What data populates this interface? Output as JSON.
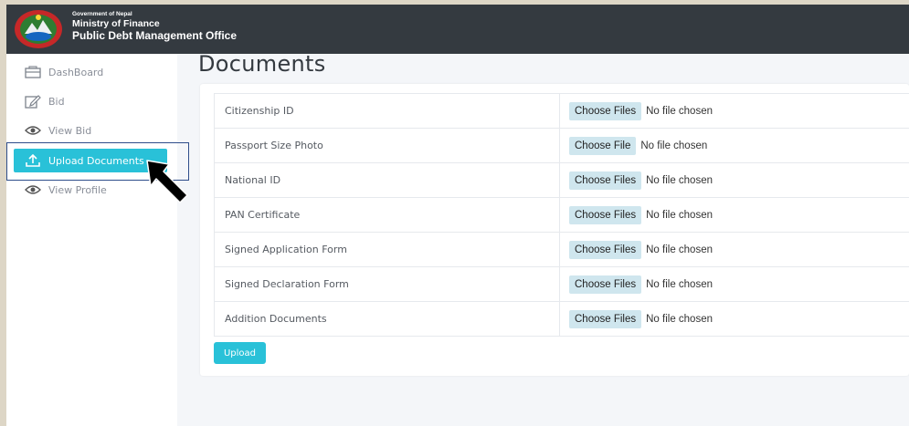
{
  "header": {
    "gov_line": "Government of Nepal",
    "ministry": "Ministry of Finance",
    "office": "Public Debt Management Office"
  },
  "sidebar": {
    "items": [
      {
        "label": "DashBoard",
        "icon": "dashboard-icon"
      },
      {
        "label": "Bid",
        "icon": "edit-icon"
      },
      {
        "label": "View Bid",
        "icon": "eye-icon"
      },
      {
        "label": "Upload Documents",
        "icon": "upload-icon",
        "active": true
      },
      {
        "label": "View Profile",
        "icon": "eye-icon"
      }
    ]
  },
  "main": {
    "title": "Documents",
    "documents": [
      {
        "label": "Citizenship ID",
        "button": "Choose Files",
        "status": "No file chosen"
      },
      {
        "label": "Passport Size Photo",
        "button": "Choose File",
        "status": "No file chosen"
      },
      {
        "label": "National ID",
        "button": "Choose Files",
        "status": "No file chosen"
      },
      {
        "label": "PAN Certificate",
        "button": "Choose Files",
        "status": "No file chosen"
      },
      {
        "label": "Signed Application Form",
        "button": "Choose Files",
        "status": "No file chosen"
      },
      {
        "label": "Signed Declaration Form",
        "button": "Choose Files",
        "status": "No file chosen"
      },
      {
        "label": "Addition Documents",
        "button": "Choose Files",
        "status": "No file chosen"
      }
    ],
    "upload_label": "Upload"
  },
  "colors": {
    "header_bg": "#343a40",
    "accent": "#29c1d8",
    "page_bg": "#f4f6f9"
  }
}
